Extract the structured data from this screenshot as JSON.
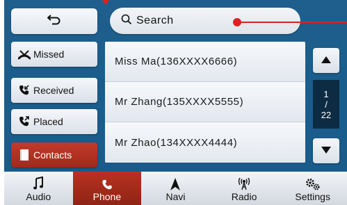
{
  "topbar": {
    "back_icon": "return-arrow-icon",
    "search_label": "Search",
    "search_icon": "magnifier-icon"
  },
  "left_menu": [
    {
      "label": "Missed",
      "icon": "missed-call-icon"
    },
    {
      "label": "Received",
      "icon": "received-call-icon"
    },
    {
      "label": "Placed",
      "icon": "placed-call-icon"
    },
    {
      "label": "Contacts",
      "icon": "contacts-book-icon",
      "active": true
    }
  ],
  "contacts": [
    {
      "text": "Miss Ma(136XXXX6666)"
    },
    {
      "text": "Mr Zhang(135XXXX5555)"
    },
    {
      "text": "Mr Zhao(134XXXX4444)"
    }
  ],
  "pager": {
    "current": "1",
    "separator": "/",
    "total": "22"
  },
  "bottom_nav": [
    {
      "label": "Audio",
      "icon": "music-note-icon"
    },
    {
      "label": "Phone",
      "icon": "phone-handset-icon",
      "active": true
    },
    {
      "label": "Navi",
      "icon": "navigation-arrow-icon"
    },
    {
      "label": "Radio",
      "icon": "radio-antenna-icon"
    },
    {
      "label": "Settings",
      "icon": "gears-icon"
    }
  ],
  "colors": {
    "background": "#1a5d8c",
    "active": "#b8321f",
    "annotation": "#e02020"
  }
}
